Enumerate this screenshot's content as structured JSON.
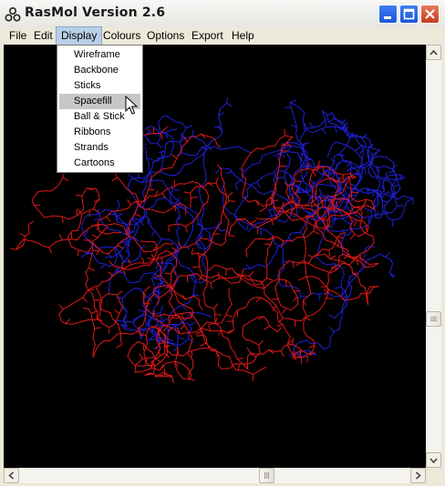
{
  "window": {
    "title": "RasMol Version 2.6"
  },
  "menubar": {
    "items": [
      {
        "label": "File"
      },
      {
        "label": "Edit"
      },
      {
        "label": "Display"
      },
      {
        "label": "Colours"
      },
      {
        "label": "Options"
      },
      {
        "label": "Export"
      },
      {
        "label": "Help"
      }
    ],
    "active": "Display"
  },
  "display_menu": {
    "items": [
      {
        "label": "Wireframe"
      },
      {
        "label": "Backbone"
      },
      {
        "label": "Sticks"
      },
      {
        "label": "Spacefill"
      },
      {
        "label": "Ball & Stick"
      },
      {
        "label": "Ribbons"
      },
      {
        "label": "Strands"
      },
      {
        "label": "Cartoons"
      }
    ],
    "highlighted": "Spacefill"
  },
  "viewport": {
    "background": "#000000",
    "chain_colors": [
      "#e01818",
      "#2020d8"
    ]
  },
  "icons": {
    "app": "rasmol-molecule-icon",
    "minimize": "minimize-icon",
    "maximize": "maximize-icon",
    "close": "close-icon",
    "cursor": "mouse-pointer-icon"
  }
}
